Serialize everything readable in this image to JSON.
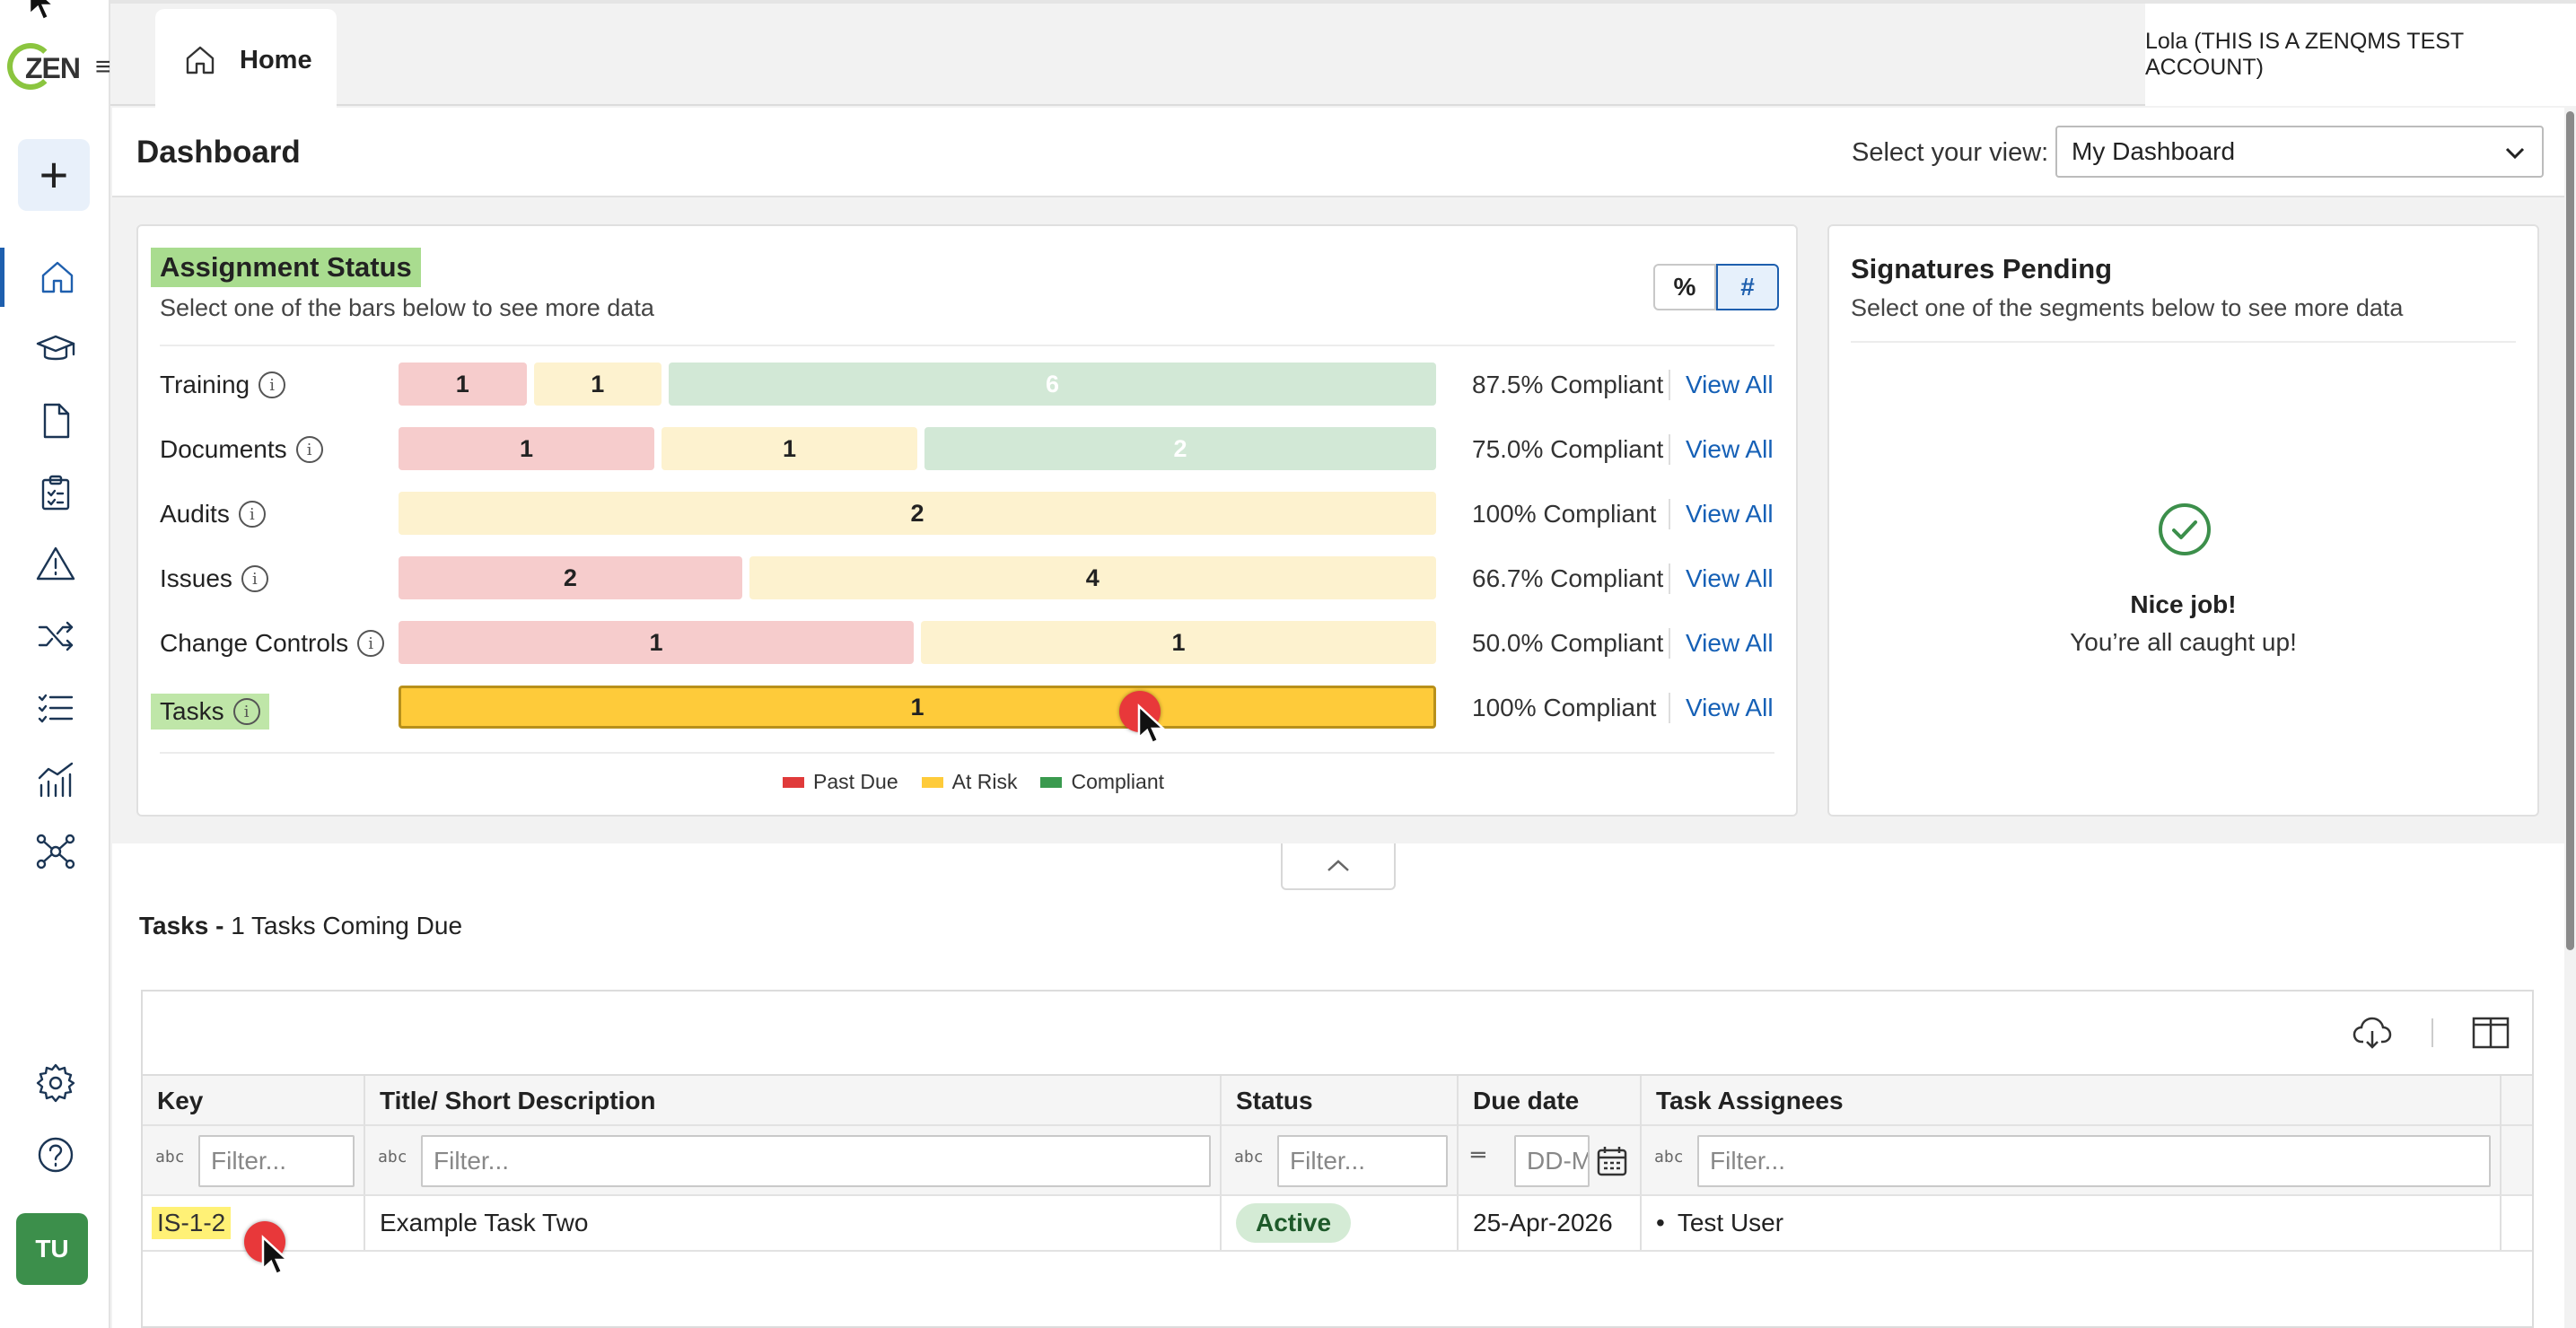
{
  "app": {
    "logo_text": "ZEN",
    "user_name": "Lola (THIS IS A ZENQMS TEST ACCOUNT)",
    "avatar_initials": "TU",
    "tab_home": "Home",
    "create_symbol": "+",
    "menu_symbol": "≡"
  },
  "nav": {
    "items": [
      "home-icon",
      "training-icon",
      "document-icon",
      "audit-clipboard-icon",
      "issues-warning-icon",
      "change-control-shuffle-icon",
      "tasks-list-icon",
      "reports-chart-icon",
      "network-icon",
      "settings-gear-icon",
      "help-icon"
    ],
    "active": "home-icon",
    "accent_color": "#1e5fae"
  },
  "dashboard": {
    "title": "Dashboard",
    "view_label": "Select your view:",
    "view_value": "My Dashboard"
  },
  "assignment_status": {
    "title": "Assignment Status",
    "subtitle": "Select one of the bars below to see more data",
    "toggle_percent": "%",
    "toggle_count": "#",
    "toggle_selected": "#",
    "rows": [
      {
        "label": "Training",
        "past_due": "1",
        "at_risk": "1",
        "compliant": "6",
        "percent": "87.5% Compliant",
        "link": "View All"
      },
      {
        "label": "Documents",
        "past_due": "1",
        "at_risk": "1",
        "compliant": "2",
        "percent": "75.0% Compliant",
        "link": "View All"
      },
      {
        "label": "Audits",
        "past_due": "",
        "at_risk": "2",
        "compliant": "",
        "percent": "100% Compliant",
        "link": "View All"
      },
      {
        "label": "Issues",
        "past_due": "2",
        "at_risk": "4",
        "compliant": "",
        "percent": "66.7% Compliant",
        "link": "View All"
      },
      {
        "label": "Change Controls",
        "past_due": "1",
        "at_risk": "1",
        "compliant": "",
        "percent": "50.0% Compliant",
        "link": "View All"
      },
      {
        "label": "Tasks",
        "past_due": "",
        "at_risk": "1",
        "compliant": "",
        "percent": "100% Compliant",
        "link": "View All",
        "selected": true
      }
    ],
    "legend": [
      "Past Due",
      "At Risk",
      "Compliant"
    ],
    "colors": {
      "past_due": "#e03a3a",
      "at_risk": "#fecb3a",
      "compliant": "#3a9a4e",
      "past_due_bar": "#f6cccc",
      "at_risk_bar": "#fdf2cf",
      "compliant_bar": "#d2e8d6"
    }
  },
  "signatures_pending": {
    "title": "Signatures Pending",
    "subtitle": "Select one of the segments below to see more data",
    "empty_title": "Nice job!",
    "empty_text": "You’re all caught up!"
  },
  "tasks_section": {
    "heading_bold": "Tasks -",
    "heading_rest": " 1 Tasks Coming Due",
    "columns": [
      "Key",
      "Title/ Short Description",
      "Status",
      "Due date",
      "Task Assignees"
    ],
    "filters": [
      "Filter...",
      "Filter...",
      "Filter...",
      "DD-M",
      "Filter..."
    ],
    "filter_type_icon": "a͏bc",
    "rows": [
      {
        "key": "IS-1-2",
        "title": "Example Task Two",
        "status": "Active",
        "due": "25-Apr-2026",
        "assignee": "Test User"
      }
    ]
  }
}
